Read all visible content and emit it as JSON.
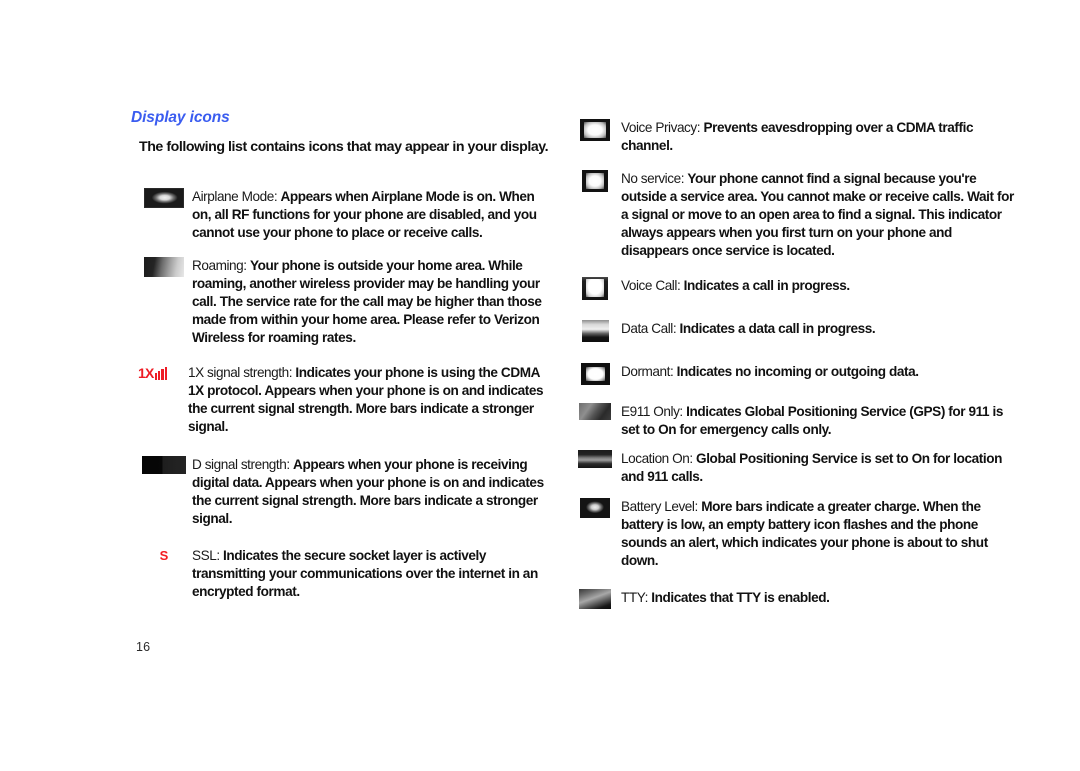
{
  "page": {
    "number": "16",
    "heading": "Display icons",
    "intro": "The following list contains icons that may appear in your display.",
    "heading_color": "#3a5cf0",
    "accent_red": "#ee1c25"
  },
  "left_column": [
    {
      "icon": "airplane-mode-icon",
      "term": "Airplane Mode",
      "separator": ":",
      "desc": "Appears when Airplane Mode is on. When on, all RF functions for your phone are disabled, and you cannot use your phone to place or receive calls."
    },
    {
      "icon": "roaming-icon",
      "term": "Roaming",
      "separator": ":",
      "desc": "Your phone is outside your home area. While roaming, another wireless provider may be handling your call. The service rate for the call may be higher than those made from within your home area. Please refer to Verizon Wireless for roaming rates."
    },
    {
      "icon": "1x-signal-strength-icon",
      "term": "1X signal strength",
      "separator": ":",
      "desc": "Indicates your phone is using the CDMA 1X protocol. Appears when your phone is on and indicates the current signal strength. More bars indicate a stronger signal."
    },
    {
      "icon": "d-signal-strength-icon",
      "term": "D signal strength",
      "separator": ":",
      "desc": "Appears when your phone is receiving digital data. Appears when your phone is on and indicates the current signal strength. More bars indicate a stronger signal."
    },
    {
      "icon": "ssl-icon",
      "term": "SSL",
      "separator": ":",
      "desc": "Indicates the secure socket layer is actively transmitting your communications over the internet in an encrypted format."
    }
  ],
  "right_column": [
    {
      "icon": "voice-privacy-icon",
      "term": "Voice Privacy",
      "separator": ":",
      "desc": "Prevents eavesdropping over a CDMA traffic channel."
    },
    {
      "icon": "no-service-icon",
      "term": "No service",
      "separator": ":",
      "desc": "Your phone cannot find a signal because you're outside a service area. You cannot make or receive calls. Wait for a signal or move to an open area to find a signal. This indicator always appears when you first turn on your phone and disappears once service is located."
    },
    {
      "icon": "voice-call-icon",
      "term": "Voice Call",
      "separator": ":",
      "desc": "Indicates a call in progress."
    },
    {
      "icon": "data-call-icon",
      "term": "Data Call",
      "separator": ":",
      "desc": "Indicates a data call in progress."
    },
    {
      "icon": "dormant-icon",
      "term": "Dormant",
      "separator": ":",
      "desc": "Indicates no incoming or outgoing data."
    },
    {
      "icon": "e911-only-icon",
      "term": "E911 Only",
      "separator": ":",
      "desc": "Indicates Global Positioning Service (GPS) for 911 is set to On for emergency calls only."
    },
    {
      "icon": "location-on-icon",
      "term": "Location On",
      "separator": ":",
      "desc": "Global Positioning Service is set to On for location and 911 calls."
    },
    {
      "icon": "battery-level-icon",
      "term": "Battery Level",
      "separator": ":",
      "desc": "More bars indicate a greater charge. When the battery is low, an empty battery icon flashes and the phone sounds an alert, which indicates your phone is about to shut down."
    },
    {
      "icon": "tty-icon",
      "term": "TTY",
      "separator": ":",
      "desc": "Indicates that TTY is enabled."
    }
  ],
  "icon_label_1x": "1X"
}
